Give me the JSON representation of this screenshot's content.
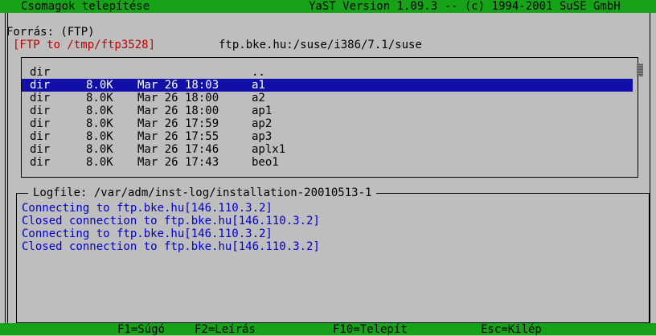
{
  "titlebar": {
    "left": "Csomagok telepítése",
    "right": "YaST Version 1.09.3 -- (c) 1994-2001 SuSE GmbH"
  },
  "source": {
    "label": "Forrás: (FTP)",
    "path": "ftp.bke.hu:/suse/i386/7.1/suse"
  },
  "ftp_target": "[FTP to /tmp/ftp3528]",
  "file_list": {
    "rows": [
      {
        "type": "dir",
        "size": "",
        "date": "",
        "name": ".."
      },
      {
        "type": "dir",
        "size": "8.0K",
        "date": "Mar 26 18:03",
        "name": "a1",
        "selected": true
      },
      {
        "type": "dir",
        "size": "8.0K",
        "date": "Mar 26 18:00",
        "name": "a2"
      },
      {
        "type": "dir",
        "size": "8.0K",
        "date": "Mar 26 18:00",
        "name": "ap1"
      },
      {
        "type": "dir",
        "size": "8.0K",
        "date": "Mar 26 17:59",
        "name": "ap2"
      },
      {
        "type": "dir",
        "size": "8.0K",
        "date": "Mar 26 17:55",
        "name": "ap3"
      },
      {
        "type": "dir",
        "size": "8.0K",
        "date": "Mar 26 17:46",
        "name": "aplx1"
      },
      {
        "type": "dir",
        "size": "8.0K",
        "date": "Mar 26 17:43",
        "name": "beo1"
      }
    ]
  },
  "log": {
    "title": "Logfile: /var/adm/inst-log/installation-20010513-1",
    "lines": [
      "Connecting to ftp.bke.hu[146.110.3.2]",
      "Closed connection to ftp.bke.hu[146.110.3.2]",
      "Connecting to ftp.bke.hu[146.110.3.2]",
      "Closed connection to ftp.bke.hu[146.110.3.2]"
    ]
  },
  "keys": {
    "f1": "F1=Súgó",
    "f2": "F2=Leírás",
    "f10": "F10=Telepít",
    "esc": "Esc=Kilép"
  },
  "colors": {
    "bar_green": "#17a317",
    "background": "#bebebe",
    "selection": "#1010a8",
    "log_text": "#0000c8",
    "ftp_text": "#c00000"
  }
}
